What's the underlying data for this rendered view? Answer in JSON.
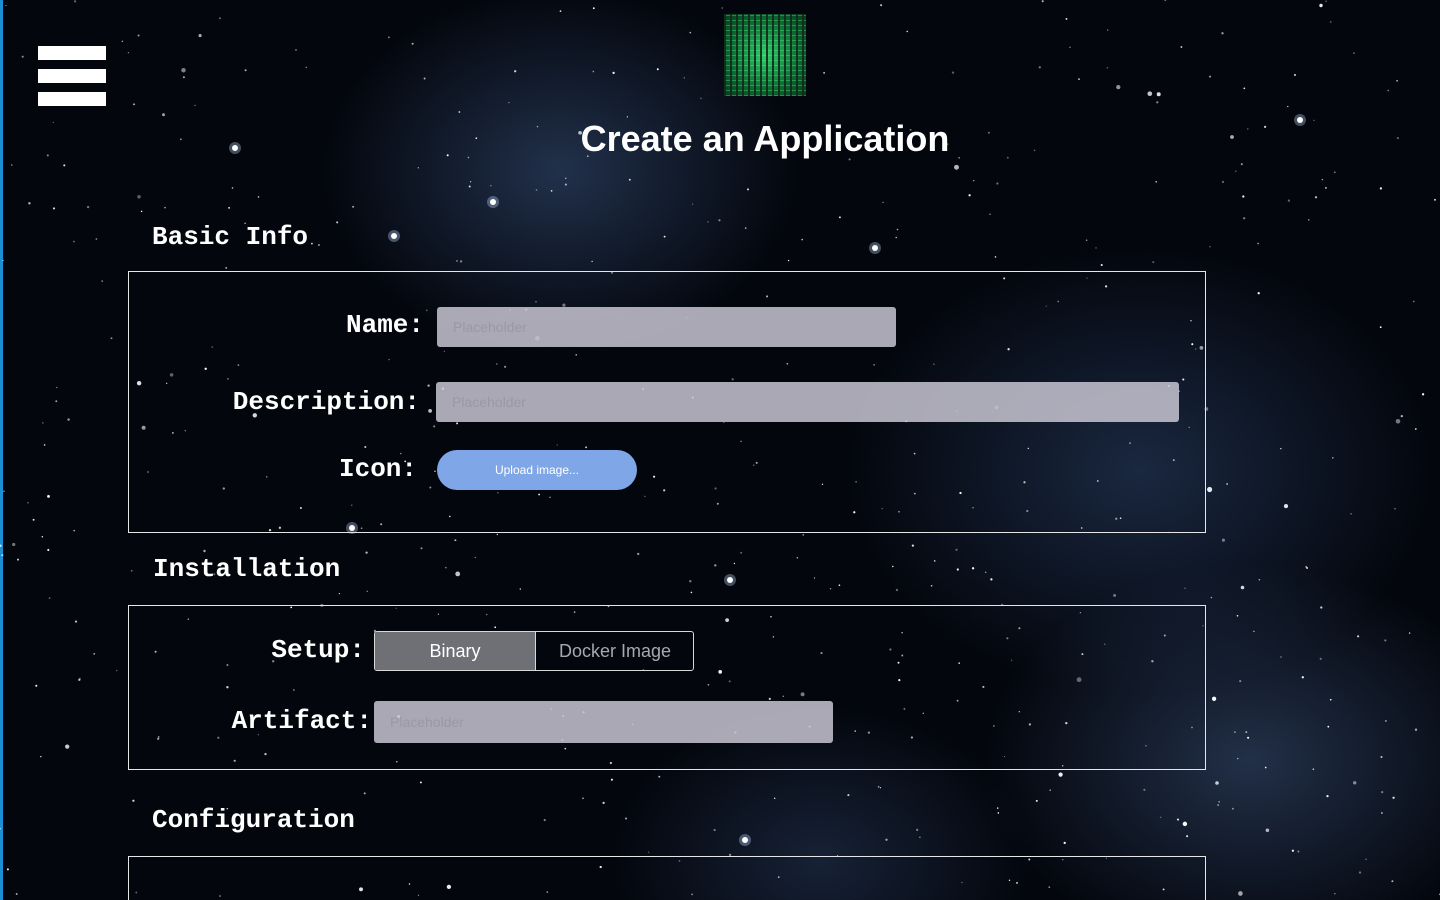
{
  "app": {
    "title": "Create an Application",
    "logo_icon": "circuit-board-logo",
    "menu_icon": "hamburger-menu-icon"
  },
  "sections": {
    "basic_info": {
      "title": "Basic Info",
      "name_label": "Name:",
      "name_placeholder": "Placeholder",
      "description_label": "Description:",
      "description_placeholder": "Placeholder",
      "icon_label": "Icon:",
      "upload_button_label": "Upload image..."
    },
    "installation": {
      "title": "Installation",
      "setup_label": "Setup:",
      "setup_options": [
        "Binary",
        "Docker Image"
      ],
      "setup_selected": "Binary",
      "artifact_label": "Artifact:",
      "artifact_placeholder": "Placeholder"
    },
    "configuration": {
      "title": "Configuration"
    }
  },
  "colors": {
    "accent_edge": "#1a8fd6",
    "upload_button": "#7fa6e6",
    "toggle_active": "#6e7076",
    "input_background": "#c8c6d2"
  }
}
